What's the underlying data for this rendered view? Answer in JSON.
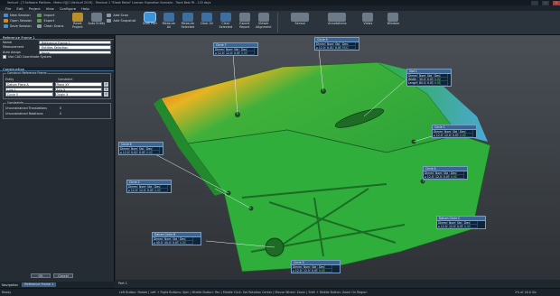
{
  "window": {
    "title": "Verisurf - [3 Software Platform - Metro IQ][C:\\Verisurf 2019] - Terminal 1 \"Sheet Metal\" License: Expiration Scenario - Track Best Fit - 143 days",
    "buttons": [
      "–",
      "□",
      "✕"
    ]
  },
  "menu": [
    "File",
    "Edit",
    "Project",
    "View",
    "Configure",
    "Help"
  ],
  "ribbon": {
    "session": [
      "New Session",
      "Open Session",
      "Save Session"
    ],
    "import": [
      "Import",
      "Export",
      "Clean Scans"
    ],
    "big1": [
      {
        "label": "Reset Project",
        "icon": "gold"
      },
      {
        "label": "Auto Entity",
        "icon": "grey"
      }
    ],
    "scan": [
      "Add Scan",
      "Add Snapshot"
    ],
    "big2": [
      {
        "label": "Scan Part",
        "icon": "blue",
        "active": true
      },
      {
        "label": "Measure All",
        "icon": "blue"
      },
      {
        "label": "Measure Selected",
        "icon": "blue"
      },
      {
        "label": "Clear All",
        "icon": "blue"
      },
      {
        "label": "Clear Selected",
        "icon": "blue"
      },
      {
        "label": "Export Report",
        "icon": "grey"
      },
      {
        "label": "Viewer Alignment",
        "icon": "grey"
      }
    ],
    "right": [
      "Sensor",
      "Annotations",
      "Views",
      "Window"
    ]
  },
  "panel": {
    "title": "Reference Frame 1",
    "fields": [
      {
        "label": "Name",
        "value": "Reference Frame 1"
      },
      {
        "label": "Measurement",
        "value": "Entities Selection"
      },
      {
        "label": "Auto Assign",
        "value": "None"
      }
    ],
    "use_cad": "Use CAD Coordinate System",
    "construction_title": "Construction",
    "construct_legend": "Construct Reference Frame",
    "col_entity": "Entity",
    "col_constraint": "Constraint",
    "constraints": [
      {
        "entity": "Datum Plane A",
        "constraint": "Plane XY"
      },
      {
        "entity": "Line 1",
        "constraint": "Axis X"
      },
      {
        "entity": "Circle 5",
        "constraint": "Origin X"
      }
    ],
    "constraints_legend": "Constraints",
    "unconstrained": [
      {
        "label": "Unconstrained Translations",
        "value": "0"
      },
      {
        "label": "Unconstrained Rotations",
        "value": "0"
      }
    ],
    "ok": "OK",
    "cancel": "Cancel"
  },
  "nav": {
    "label": "Navigation",
    "tab": "Reference Frame 1"
  },
  "viewport_tab": "Part 1",
  "annotations": [
    {
      "title": "Circle 7",
      "rows": [
        [
          "Dimension",
          "Nom",
          "Std",
          "Dev"
        ],
        [
          "⌀ 12.000",
          "12.011",
          "0.050",
          "0.011"
        ]
      ]
    },
    {
      "title": "Circle 9",
      "rows": [
        [
          "Dimension",
          "Nom",
          "Std",
          "Dev"
        ],
        [
          "⌀ 12.000",
          "0.016",
          "0.050",
          "PASS"
        ]
      ]
    },
    {
      "title": "Slot 1",
      "rows": [
        [
          "Dimension",
          "Nom",
          "Std",
          "Dev"
        ],
        [
          "Width",
          "30.022",
          "0.050",
          "0.022"
        ],
        [
          "Length",
          "80.015",
          "0.050",
          "0.015"
        ]
      ]
    },
    {
      "title": "Circle 6",
      "rows": [
        [
          "Dimension",
          "Nom",
          "Std",
          "Dev"
        ],
        [
          "⌀ 12.000",
          "0.021",
          "0.050",
          "0.021"
        ]
      ]
    },
    {
      "title": "Circle 1",
      "rows": [
        [
          "Dimension",
          "Nom",
          "Std",
          "Dev"
        ],
        [
          "⌀ 12.000",
          "12.009",
          "0.050",
          "0.009"
        ]
      ]
    },
    {
      "title": "Circle 4",
      "rows": [
        [
          "Dimension",
          "Nom",
          "Std",
          "Dev"
        ],
        [
          "⌀ 12.000",
          "12.014",
          "0.050",
          "0.014"
        ]
      ]
    },
    {
      "title": "Circle 2",
      "rows": [
        [
          "Dimension",
          "Nom",
          "Std",
          "Dev"
        ],
        [
          "⌀ 12.000",
          "12.018",
          "0.050",
          "0.018"
        ]
      ]
    },
    {
      "title": "Datum Circle C",
      "rows": [
        [
          "Dimension",
          "Nom",
          "Std",
          "Dev"
        ],
        [
          "⌀ 12.000",
          "12.007",
          "0.050",
          "0.007"
        ]
      ]
    },
    {
      "title": "Datum Circle B",
      "rows": [
        [
          "Dimension",
          "Nom",
          "Std",
          "Dev"
        ],
        [
          "⌀ 40.000",
          "40.012",
          "0.050",
          "0.012"
        ]
      ]
    },
    {
      "title": "Circle 5",
      "rows": [
        [
          "Dimension",
          "Nom",
          "Std",
          "Dev"
        ],
        [
          "⌀ 12.000",
          "12.010",
          "0.050",
          "0.010"
        ]
      ]
    }
  ],
  "status": {
    "ready": "Ready",
    "hints": "Left Button: Rotate | Left + Right Buttons: Spin | Middle Button: Pan | Middle Click: Set Rotation Center | Mouse Wheel: Zoom | Shift + Middle Button: Zoom On Region",
    "mem": "2% of 16.0 Gb"
  },
  "colors": {
    "part": "#2fae3c",
    "accent": "#3b6693"
  }
}
